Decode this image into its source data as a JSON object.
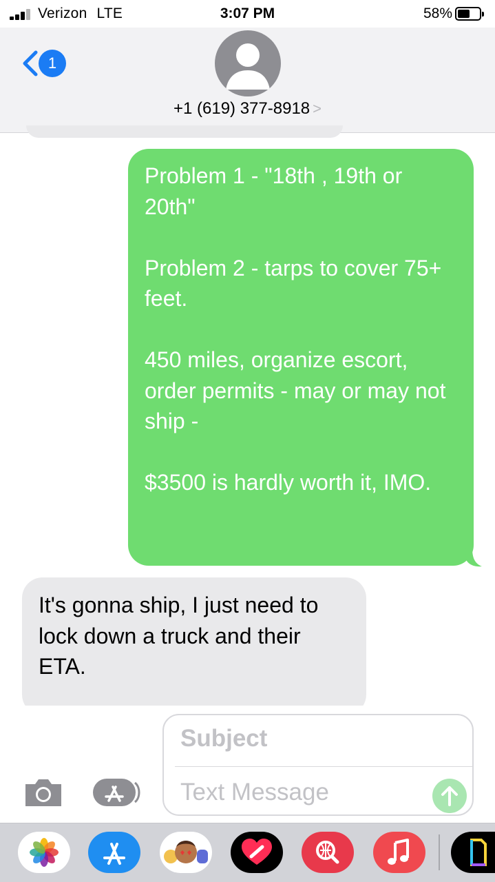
{
  "status_bar": {
    "carrier": "Verizon",
    "network": "LTE",
    "time": "3:07 PM",
    "battery_percent": "58%",
    "battery_level": 0.58
  },
  "header": {
    "back_badge": "1",
    "contact": "+1 (619) 377-8918",
    "contact_chevron": ">"
  },
  "messages": [
    {
      "direction": "outgoing",
      "text": "Problem 1 - \"18th , 19th or 20th\"\n\nProblem 2 - tarps to cover 75+ feet.\n\n450 miles, organize escort, order permits - may or may not ship -\n\n$3500 is hardly worth it, IMO."
    },
    {
      "direction": "incoming",
      "text": "It's gonna ship, I just need to lock down a truck and their ETA."
    }
  ],
  "composer": {
    "subject_placeholder": "Subject",
    "message_placeholder": "Text Message"
  },
  "app_drawer": [
    "photos-icon",
    "app-store-icon",
    "memoji-icon",
    "heartbeat-icon",
    "web-search-icon",
    "music-icon",
    "gif-icon"
  ],
  "colors": {
    "outgoing_bubble": "#6fdc70",
    "incoming_bubble": "#e9e9eb",
    "accent": "#1b7cf4"
  }
}
